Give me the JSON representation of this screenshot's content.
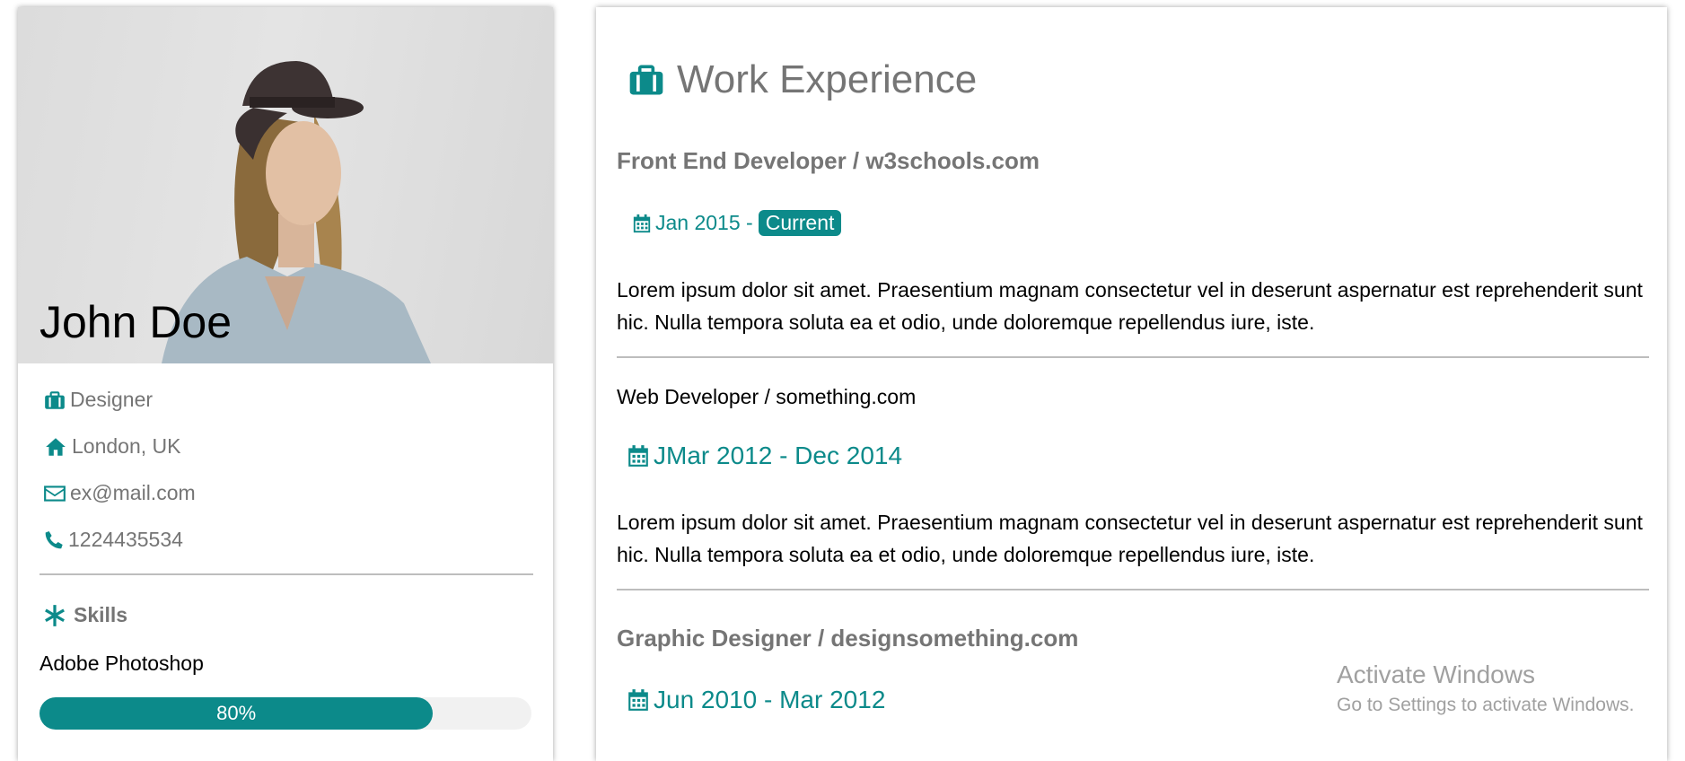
{
  "profile": {
    "name": "John Doe",
    "details": [
      {
        "icon": "briefcase-icon",
        "text": "Designer"
      },
      {
        "icon": "home-icon",
        "text": "London, UK"
      },
      {
        "icon": "envelope-icon",
        "text": " ex@mail.com"
      },
      {
        "icon": "phone-icon",
        "text": "1224435534"
      }
    ],
    "skills_title": "Skills",
    "skills": [
      {
        "name": "Adobe Photoshop",
        "label": "80%",
        "percent": 80
      }
    ]
  },
  "work": {
    "title": "Work Experience",
    "jobs": [
      {
        "title": "Front End Developer / w3schools.com",
        "date": "Jan 2015 - ",
        "tag": "Current",
        "description": "Lorem ipsum dolor sit amet. Praesentium magnam consectetur vel in deserunt aspernatur est reprehenderit sunt hic. Nulla tempora soluta ea et odio, unde doloremque repellendus iure, iste."
      },
      {
        "title": "Web Developer / something.com",
        "date": "JMar 2012 - Dec 2014",
        "description": "Lorem ipsum dolor sit amet. Praesentium magnam consectetur vel in deserunt aspernatur est reprehenderit sunt hic. Nulla tempora soluta ea et odio, unde doloremque repellendus iure, iste."
      },
      {
        "title": "Graphic Designer / designsomething.com",
        "date": "Jun 2010 - Mar 2012"
      }
    ]
  },
  "watermark": {
    "line1": "Activate Windows",
    "line2": "Go to Settings to activate Windows."
  },
  "colors": {
    "accent": "#0c8a8a",
    "muted_text": "#757575"
  }
}
